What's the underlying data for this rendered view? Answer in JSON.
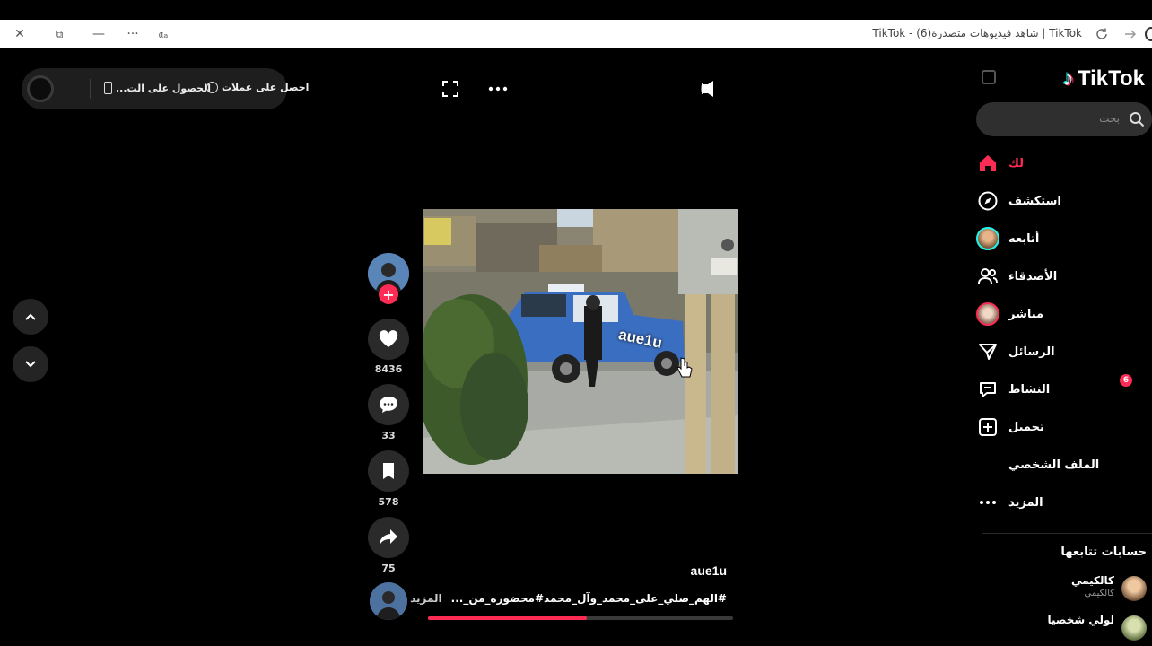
{
  "browser": {
    "tab_title": "TikTok | شاهد فيديوهات متصدرة(6) - TikTok",
    "buttons": {
      "close": "✕",
      "restore": "⧉",
      "minimize": "—",
      "more": "···",
      "read_aloud": "𝔞ₐ"
    }
  },
  "sidebar": {
    "logo": "TikTok",
    "search_placeholder": "بحث",
    "nav": [
      {
        "label": "لك",
        "icon": "home-icon",
        "active": true
      },
      {
        "label": "استكشف",
        "icon": "compass-icon"
      },
      {
        "label": "أتابعه",
        "icon": "following-avatar-icon"
      },
      {
        "label": "الأصدقاء",
        "icon": "friends-icon"
      },
      {
        "label": "مباشر",
        "icon": "live-avatar-icon"
      },
      {
        "label": "الرسائل",
        "icon": "send-icon"
      },
      {
        "label": "النشاط",
        "icon": "activity-icon",
        "badge": "6"
      },
      {
        "label": "تحميل",
        "icon": "upload-icon"
      },
      {
        "label": "الملف الشخصي",
        "icon": "profile-icon"
      },
      {
        "label": "المزيد",
        "icon": "more-icon"
      }
    ],
    "following_title": "حسابات تتابعها",
    "accounts": [
      {
        "name": "كالكيمي",
        "handle": "كالكيمي"
      },
      {
        "name": "لولي شخصيا",
        "handle": ""
      }
    ]
  },
  "top_pill": {
    "get_coins": "احصل على عملات",
    "get_app": "الحصول على الت..."
  },
  "video": {
    "watermark": "aue1u",
    "author": "aue1u",
    "description": "#الهم_صلي_على_محمد_وآل_محمد#محضوره_من_...",
    "more": "المزيد",
    "progress_fraction": 0.52
  },
  "actions": {
    "likes": "8436",
    "comments": "33",
    "saves": "578",
    "shares": "75"
  },
  "colors": {
    "accent": "#fe2c55",
    "background": "#000000",
    "cyan": "#25f4ee"
  }
}
